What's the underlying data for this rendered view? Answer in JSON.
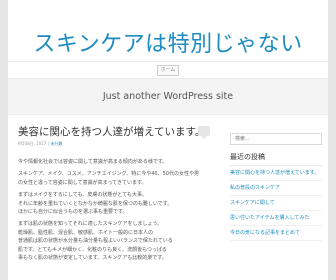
{
  "site": {
    "title": "スキンケアは特別じゃない",
    "tagline": "Just another WordPress site"
  },
  "nav": {
    "home_label": "ホーム"
  },
  "post": {
    "title": "美容に関心を持つ人達が増えています。",
    "date": "9月08日, 2017",
    "meta_sep": " | ",
    "category": "未分類",
    "paragraphs": [
      "今や情報化社会では容姿に関して意識が高まる傾向がある様です。",
      "スキンケア、メイク、コスメ、アンチエイジング、特に今や40、50代の女性や男",
      "の女性と違って容姿に関して意識が高まってきています。",
      "まずはメイクをするにしても、皮膚の状態がとても大事。",
      "それに年齢を重ねていくとなかなか綺麗な肌を保つのも難しいです。",
      "ほかにも自分に似合うものを選ぶ事も重要です。",
      "まずは肌の状態を知ってそれに適したスキンケアをしましょう。",
      "乾燥肌、脂性肌、混合肌、敏感肌、ホイト一般的に日本人の",
      "普通肌は肌の状態が水分量も油分量も程よいバランスで保たれている",
      "肌です。とてもキメが細かく、化粧のりも良く、洗顔後もつっぱる",
      "事もなく肌の状態が安定しています。スキンケアも比較的楽です。"
    ]
  },
  "sidebar": {
    "search_placeholder": "検索...",
    "recent_title": "最近の投稿",
    "recent_posts": [
      "美容に関心を持つ人達が増えています。",
      "私の普段のスキンケア",
      "スキンケアに関して",
      "思い付いたアイテムを購入してみた",
      "今日の気になる記事をまとめて"
    ]
  }
}
